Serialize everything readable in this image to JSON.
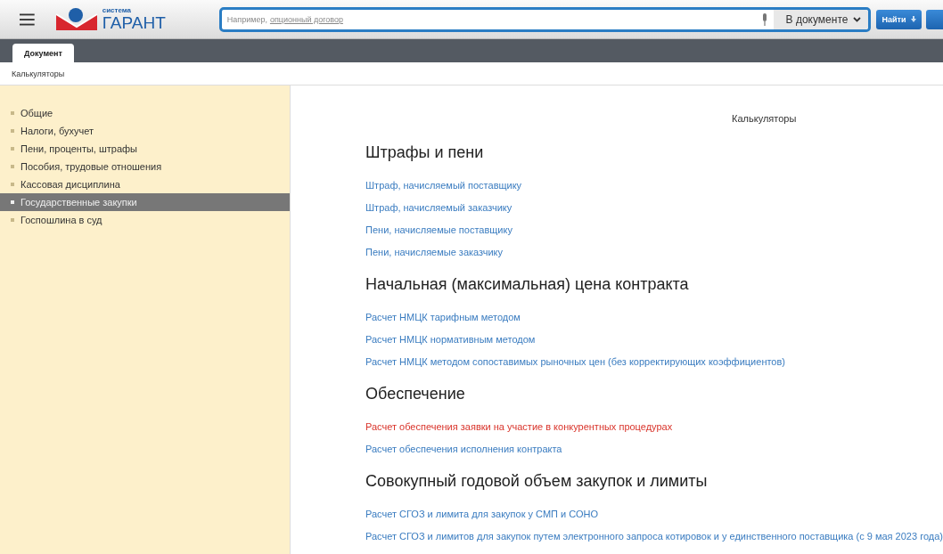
{
  "header": {
    "logo": {
      "small": "система",
      "big": "ГАРАНТ"
    },
    "search": {
      "hint": "Например,",
      "hint_link": "опционный договор",
      "scope": "В документе",
      "button": "Найти"
    }
  },
  "tabs": [
    {
      "label": "Документ",
      "selected": true
    }
  ],
  "breadcrumb": "Калькуляторы",
  "sidebar": {
    "items": [
      {
        "label": "Общие",
        "selected": false
      },
      {
        "label": "Налоги, бухучет",
        "selected": false
      },
      {
        "label": "Пени, проценты, штрафы",
        "selected": false
      },
      {
        "label": "Пособия, трудовые отношения",
        "selected": false
      },
      {
        "label": "Кассовая дисциплина",
        "selected": false
      },
      {
        "label": "Государственные закупки",
        "selected": true
      },
      {
        "label": "Госпошлина в суд",
        "selected": false
      }
    ]
  },
  "content": {
    "title": "Калькуляторы",
    "sections": [
      {
        "heading": "Штрафы и пени",
        "links": [
          {
            "text": "Штраф, начисляемый поставщику",
            "color": "#3a7cc0"
          },
          {
            "text": "Штраф, начисляемый заказчику",
            "color": "#3a7cc0"
          },
          {
            "text": "Пени, начисляемые поставщику",
            "color": "#3a7cc0"
          },
          {
            "text": "Пени, начисляемые заказчику",
            "color": "#3a7cc0"
          }
        ]
      },
      {
        "heading": "Начальная (максимальная) цена контракта",
        "links": [
          {
            "text": "Расчет НМЦК тарифным методом",
            "color": "#3a7cc0"
          },
          {
            "text": "Расчет НМЦК нормативным методом",
            "color": "#3a7cc0"
          },
          {
            "text": "Расчет НМЦК методом сопоставимых рыночных цен (без корректирующих коэффициентов)",
            "color": "#3a7cc0"
          }
        ]
      },
      {
        "heading": "Обеспечение",
        "links": [
          {
            "text": "Расчет обеспечения заявки на участие в конкурентных процедурах",
            "color": "#d9342b"
          },
          {
            "text": "Расчет обеспечения исполнения контракта",
            "color": "#3a7cc0"
          }
        ]
      },
      {
        "heading": "Совокупный годовой объем закупок и лимиты",
        "links": [
          {
            "text": "Расчет СГОЗ и лимита для закупок у СМП и СОНО",
            "color": "#3a7cc0"
          },
          {
            "text": "Расчет СГОЗ и лимитов для закупок путем электронного запроса котировок и у единственного поставщика (с 9 мая 2023 года)",
            "color": "#3a7cc0"
          }
        ]
      }
    ]
  }
}
